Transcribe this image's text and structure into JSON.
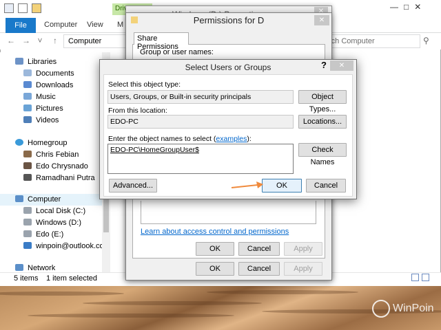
{
  "explorer": {
    "file_tab": "File",
    "tabs": [
      "Computer",
      "View",
      "M"
    ],
    "drive_tools": "Driv",
    "title": "Windows (D:) Properties",
    "address": "Computer",
    "search_placeholder": "rch Computer",
    "nav": {
      "libraries": "Libraries",
      "documents": "Documents",
      "downloads": "Downloads",
      "music": "Music",
      "pictures": "Pictures",
      "videos": "Videos",
      "homegroup": "Homegroup",
      "hg_user1": "Chris Febian",
      "hg_user2": "Edo Chrysnado",
      "hg_user3": "Ramadhani Putra",
      "computer": "Computer",
      "local_disk": "Local Disk (C:)",
      "windows_d": "Windows (D:)",
      "edo_e": "Edo (E:)",
      "winpoin": "winpoin@outlook.com",
      "network": "Network"
    },
    "status_items": "5 items",
    "status_selected": "1 item selected"
  },
  "properties": {
    "ok": "OK",
    "cancel": "Cancel",
    "apply": "Apply"
  },
  "permissions": {
    "title": "Permissions for D",
    "tab": "Share Permissions",
    "groups_label": "Group or user names:",
    "link": "Learn about access control and permissions",
    "ok": "OK",
    "cancel": "Cancel",
    "apply": "Apply"
  },
  "select_users": {
    "title": "Select Users or Groups",
    "help": "?",
    "object_type_label": "Select this object type:",
    "object_type_value": "Users, Groups, or Built-in security principals",
    "object_types_button": "Object Types...",
    "location_label": "From this location:",
    "location_value": "EDO-PC",
    "locations_button": "Locations...",
    "names_label_prefix": "Enter the object names to select (",
    "names_label_link": "examples",
    "names_label_suffix": "):",
    "names_value": "EDO-PC\\HomeGroupUser$",
    "check_names_button": "Check Names",
    "advanced_button": "Advanced...",
    "ok_button": "OK",
    "cancel_button": "Cancel"
  },
  "watermark": "WinPoin",
  "colors": {
    "file_tab": "#1979ca",
    "link": "#0066cc",
    "annotation_arrow": "#f08a3c",
    "drive_tools": "#c7e7a7"
  }
}
